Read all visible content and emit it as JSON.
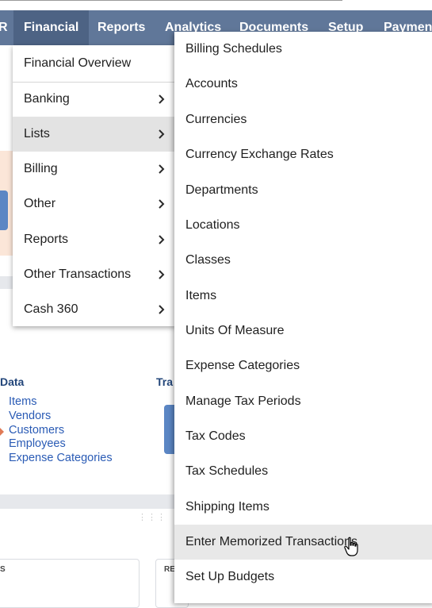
{
  "navbar": {
    "items": [
      {
        "label": "R"
      },
      {
        "label": "Financial"
      },
      {
        "label": "Reports"
      },
      {
        "label": "Analytics"
      },
      {
        "label": "Documents"
      },
      {
        "label": "Setup"
      },
      {
        "label": "Payments"
      }
    ]
  },
  "background": {
    "data_heading": "Data",
    "tra_heading": "Tra",
    "links": [
      "Items",
      "Vendors",
      "Customers",
      "Employees",
      "Expense Categories"
    ],
    "card1_label": "S",
    "card2_label": "RE"
  },
  "financial_menu": {
    "items": [
      {
        "label": "Financial Overview"
      },
      {
        "label": "Banking"
      },
      {
        "label": "Lists"
      },
      {
        "label": "Billing"
      },
      {
        "label": "Other"
      },
      {
        "label": "Reports"
      },
      {
        "label": "Other Transactions"
      },
      {
        "label": "Cash 360"
      }
    ]
  },
  "lists_submenu": {
    "items": [
      {
        "label": "Billing Schedules"
      },
      {
        "label": "Accounts"
      },
      {
        "label": "Currencies"
      },
      {
        "label": "Currency Exchange Rates"
      },
      {
        "label": "Departments"
      },
      {
        "label": "Locations"
      },
      {
        "label": "Classes"
      },
      {
        "label": "Items"
      },
      {
        "label": "Units Of Measure"
      },
      {
        "label": "Expense Categories"
      },
      {
        "label": "Manage Tax Periods"
      },
      {
        "label": "Tax Codes"
      },
      {
        "label": "Tax Schedules"
      },
      {
        "label": "Shipping Items"
      },
      {
        "label": "Enter Memorized Transactions"
      },
      {
        "label": "Set Up Budgets"
      }
    ]
  }
}
